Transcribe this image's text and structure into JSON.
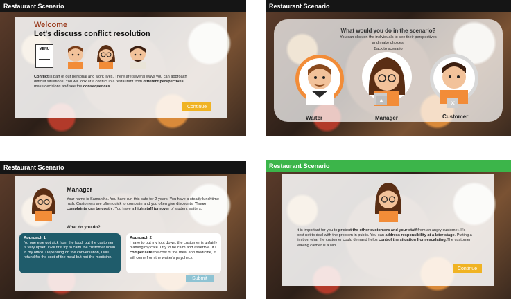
{
  "app_title": "Restaurant Scenario",
  "p1": {
    "welcome": "Welcome",
    "heading": "Let's discuss conflict resolution",
    "menu_label": "MENU",
    "body": [
      {
        "t": "Conflict",
        "b": true
      },
      {
        "t": " is part of our personal and work lives. There are several ways you can approach difficult situations. You will look at a conflict in a restaurant from ",
        "b": false
      },
      {
        "t": "different perspectives",
        "b": true
      },
      {
        "t": ", make decisions and see the ",
        "b": false
      },
      {
        "t": "consequences",
        "b": true
      },
      {
        "t": ".",
        "b": false
      }
    ],
    "button": "Continue"
  },
  "p2": {
    "question": "What would you do in the scenario?",
    "instr1": "You can click on the individuals to see their perspectives",
    "instr2": "and make choices.",
    "back": "Back to scenario",
    "labels": [
      "Waiter",
      "Manager",
      "Customer"
    ]
  },
  "p3": {
    "title": "Manager",
    "body": [
      {
        "t": "Your name is Samantha. You have run this cafe for 2 years. You have a steady lunchtime rush. Customers are often quick to complain and you often give discounts. ",
        "b": false
      },
      {
        "t": "These complaints can be costly",
        "b": true
      },
      {
        "t": ". You have a ",
        "b": false
      },
      {
        "t": "high staff turnover",
        "b": true
      },
      {
        "t": " of student waiters.",
        "b": false
      }
    ],
    "question": "What do you do?",
    "a1_title": "Approach 1",
    "a1_text": "No one else got sick from the food, but the customer is very upset. I will first try to calm the customer down in my office. Depending on the conversation, I will refund for the cost of the meal but not the medicine.",
    "a2_title": "Approach 2",
    "a2_body": [
      {
        "t": "I have to put my foot down, the customer is unfairly blaming my cafe. I try to be calm and assertive. If I ",
        "b": false
      },
      {
        "t": "compensate",
        "b": true
      },
      {
        "t": " the cost of the meal and medicine, it will come from the waiter's paycheck.",
        "b": false
      }
    ],
    "submit": "Submit"
  },
  "p4": {
    "body": [
      {
        "t": "It is important for you to ",
        "b": false
      },
      {
        "t": "protect the other customers and your staff",
        "b": true
      },
      {
        "t": " from an angry customer. It's best not to deal with the problem in public. You can ",
        "b": false
      },
      {
        "t": "address responsibility at a later stage",
        "b": true
      },
      {
        "t": ". Putting a limit on what the customer could demand helps ",
        "b": false
      },
      {
        "t": "control the situation from escalating",
        "b": true
      },
      {
        "t": ".The customer leaving calmer is a win.",
        "b": false
      }
    ],
    "button": "Continue"
  },
  "colors": {
    "accent": "#f0b323",
    "teal": "#1f5c6b",
    "green": "#3cb54a",
    "submit": "#8ec3d3"
  }
}
